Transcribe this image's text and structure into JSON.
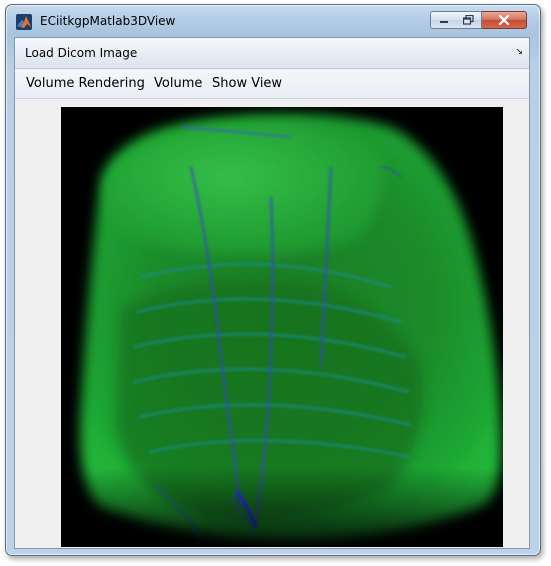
{
  "window": {
    "title": "ECiitkgpMatlab3DView",
    "app_icon": "matlab-icon",
    "controls": {
      "minimize_icon": "minimize-icon",
      "maximize_icon": "maximize-icon",
      "close_icon": "close-icon"
    }
  },
  "menubar": {
    "items": [
      {
        "label": "Load Dicom Image"
      }
    ],
    "overflow_icon": "chevron-menu-icon"
  },
  "toolbar": {
    "items": [
      {
        "label": "Volume Rendering"
      },
      {
        "label": "Volume"
      },
      {
        "label": "Show View"
      }
    ]
  },
  "viewer": {
    "content": "volume-rendered-chest-ct",
    "colors": {
      "background": "#000000",
      "tissue": "#1f9a2a",
      "bone": "#2c3fae"
    }
  },
  "colors": {
    "titlebar": "#b9d1ea",
    "close_button": "#c9503a",
    "panel": "#f0f0f0"
  }
}
